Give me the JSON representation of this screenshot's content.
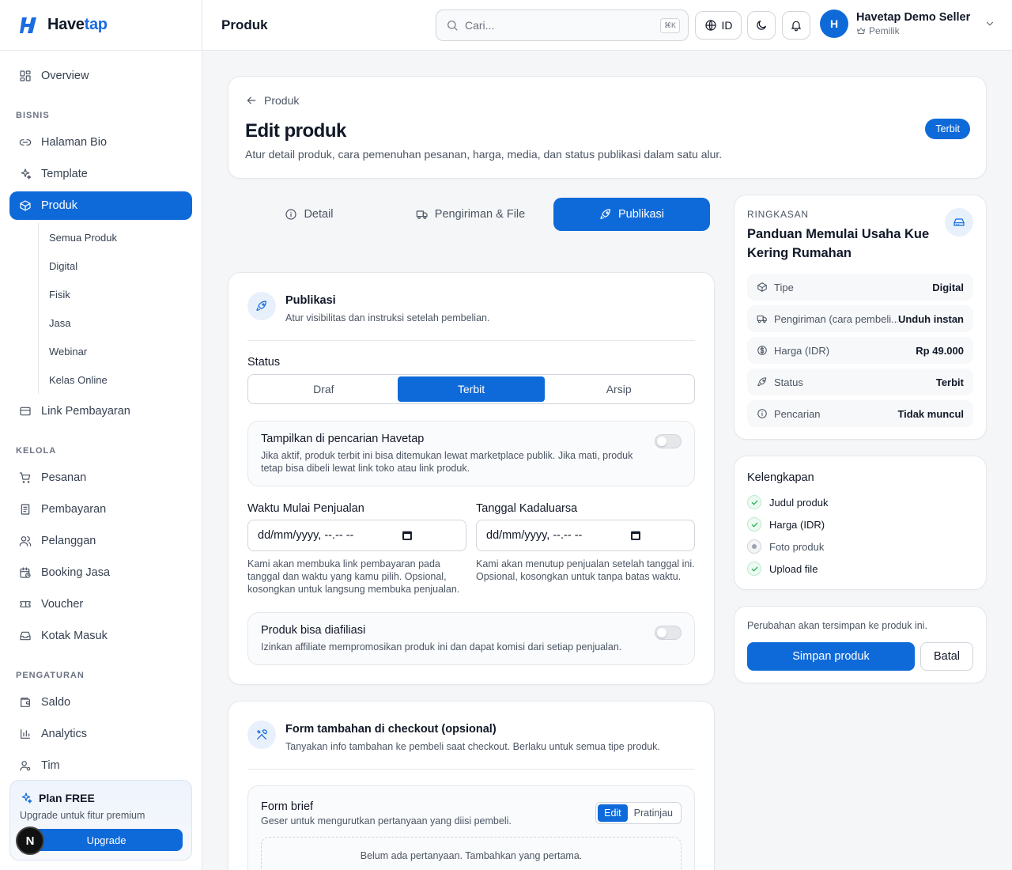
{
  "brand": {
    "name_a": "Have",
    "name_b": "tap"
  },
  "sidebar": {
    "overview": "Overview",
    "section_bisnis": "BISNIS",
    "halaman_bio": "Halaman Bio",
    "template": "Template",
    "produk": "Produk",
    "produk_sub": [
      "Semua Produk",
      "Digital",
      "Fisik",
      "Jasa",
      "Webinar",
      "Kelas Online"
    ],
    "link_pembayaran": "Link Pembayaran",
    "section_kelola": "KELOLA",
    "pesanan": "Pesanan",
    "pembayaran": "Pembayaran",
    "pelanggan": "Pelanggan",
    "booking_jasa": "Booking Jasa",
    "voucher": "Voucher",
    "kotak_masuk": "Kotak Masuk",
    "section_pengaturan": "PENGATURAN",
    "saldo": "Saldo",
    "analytics": "Analytics",
    "tim": "Tim",
    "plan": {
      "title": "Plan FREE",
      "subtitle": "Upgrade untuk fitur premium",
      "button": "Upgrade",
      "badge": "N"
    }
  },
  "header": {
    "title": "Produk",
    "search_placeholder": "Cari...",
    "search_shortcut": "⌘K",
    "lang": "ID",
    "user": {
      "initial": "H",
      "name": "Havetap Demo Seller",
      "role": "Pemilik"
    }
  },
  "page": {
    "back_label": "Produk",
    "title": "Edit produk",
    "subtitle": "Atur detail produk, cara pemenuhan pesanan, harga, media, dan status publikasi dalam satu alur.",
    "status_badge": "Terbit"
  },
  "tabs": [
    "Detail",
    "Pengiriman & File",
    "Publikasi"
  ],
  "publikasi": {
    "title": "Publikasi",
    "subtitle": "Atur visibilitas dan instruksi setelah pembelian.",
    "status_label": "Status",
    "status_options": [
      "Draf",
      "Terbit",
      "Arsip"
    ],
    "status_selected": "Terbit",
    "search_toggle": {
      "title": "Tampilkan di pencarian Havetap",
      "desc": "Jika aktif, produk terbit ini bisa ditemukan lewat marketplace publik. Jika mati, produk tetap bisa dibeli lewat link toko atau link produk.",
      "on": false
    },
    "start_label": "Waktu Mulai Penjualan",
    "start_placeholder": "dd/mm/yyyy, --.-- --",
    "start_help": "Kami akan membuka link pembayaran pada tanggal dan waktu yang kamu pilih. Opsional, kosongkan untuk langsung membuka penjualan.",
    "end_label": "Tanggal Kadaluarsa",
    "end_placeholder": "dd/mm/yyyy, --.-- --",
    "end_help": "Kami akan menutup penjualan setelah tanggal ini. Opsional, kosongkan untuk tanpa batas waktu.",
    "affiliate_toggle": {
      "title": "Produk bisa diafiliasi",
      "desc": "Izinkan affiliate mempromosikan produk ini dan dapat komisi dari setiap penjualan.",
      "on": false
    }
  },
  "checkout_form": {
    "title": "Form tambahan di checkout (opsional)",
    "subtitle": "Tanyakan info tambahan ke pembeli saat checkout. Berlaku untuk semua tipe produk.",
    "brief_title": "Form brief",
    "brief_sub": "Geser untuk mengurutkan pertanyaan yang diisi pembeli.",
    "mode_options": [
      "Edit",
      "Pratinjau"
    ],
    "empty": "Belum ada pertanyaan. Tambahkan yang pertama."
  },
  "summary": {
    "eyebrow": "RINGKASAN",
    "product_title": "Panduan Memulai Usaha Kue Kering Rumahan",
    "rows": [
      {
        "key": "Tipe",
        "value": "Digital",
        "icon": "box-icon"
      },
      {
        "key": "Pengiriman (cara pembeli...",
        "value": "Unduh instan",
        "icon": "truck-icon"
      },
      {
        "key": "Harga (IDR)",
        "value": "Rp 49.000",
        "icon": "dollar-icon"
      },
      {
        "key": "Status",
        "value": "Terbit",
        "icon": "rocket-icon"
      },
      {
        "key": "Pencarian",
        "value": "Tidak muncul",
        "icon": "info-icon"
      }
    ]
  },
  "completeness": {
    "title": "Kelengkapan",
    "items": [
      {
        "label": "Judul produk",
        "done": true
      },
      {
        "label": "Harga (IDR)",
        "done": true
      },
      {
        "label": "Foto produk",
        "done": false
      },
      {
        "label": "Upload file",
        "done": true
      }
    ]
  },
  "save": {
    "note": "Perubahan akan tersimpan ke produk ini.",
    "primary": "Simpan produk",
    "cancel": "Batal"
  },
  "colors": {
    "accent": "#0f6ad9",
    "success": "#16a34a"
  }
}
